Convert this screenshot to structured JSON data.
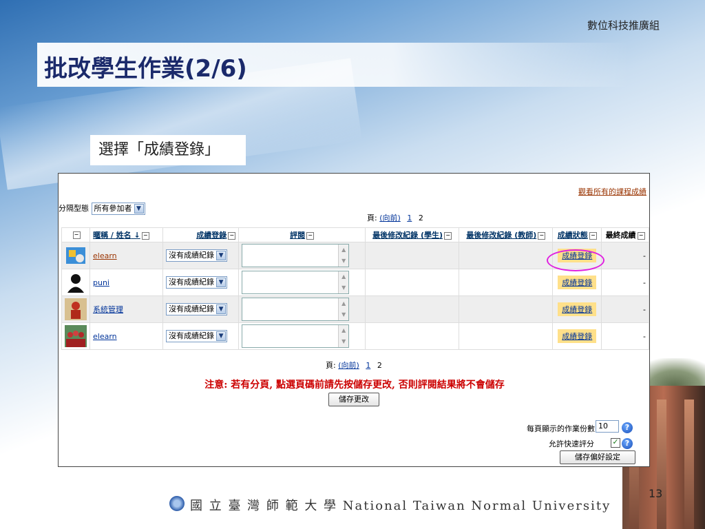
{
  "slide": {
    "department": "數位科技推廣組",
    "title": "批改學生作業(2/6)",
    "callout": "選擇「成績登錄」",
    "page_number": "13",
    "footer": "國 立 臺 灣 師 範 大 學  National Taiwan Normal University"
  },
  "moodle": {
    "view_all_grades_link": "觀看所有的課程成績",
    "group_mode_label": "分隔型態",
    "group_mode_value": "所有參加者",
    "pager_top": {
      "label": "頁:",
      "prev": "(向前)",
      "pages": [
        "1",
        "2"
      ]
    },
    "pager_bottom": {
      "label": "頁:",
      "prev": "(向前)",
      "pages": [
        "1",
        "2"
      ]
    },
    "columns": {
      "toggle": "−",
      "nickname": "暱稱",
      "slash": " / ",
      "name": "姓名",
      "sort_arrow": "↓",
      "grade_entry": "成績登錄",
      "comment": "評閱",
      "last_mod_student": "最後修改紀錄 (學生)",
      "last_mod_teacher": "最後修改紀錄 (教師)",
      "status": "成績狀態",
      "final_grade": "最終成績"
    },
    "rows": [
      {
        "name": "elearn",
        "grade_select": "沒有成績紀錄",
        "status_button": "成績登錄",
        "final": "-",
        "avatar": "app-icon"
      },
      {
        "name": "puni",
        "grade_select": "沒有成績紀錄",
        "status_button": "成績登錄",
        "final": "-",
        "avatar": "silhouette-icon"
      },
      {
        "name": "系統管理",
        "grade_select": "沒有成績紀錄",
        "status_button": "成績登錄",
        "final": "-",
        "avatar": "figure-icon"
      },
      {
        "name": "elearn",
        "grade_select": "沒有成績紀錄",
        "status_button": "成績登錄",
        "final": "-",
        "avatar": "group-photo"
      }
    ],
    "warning": "注意: 若有分頁, 點選頁碼前請先按儲存更改, 否則評閱結果將不會儲存",
    "save_changes": "儲存更改",
    "per_page_label": "每頁顯示的作業份數",
    "per_page_value": "10",
    "quick_grade_label": "允許快速評分",
    "quick_grade_checked": "✓",
    "save_prefs": "儲存偏好設定",
    "help_glyph": "?"
  }
}
